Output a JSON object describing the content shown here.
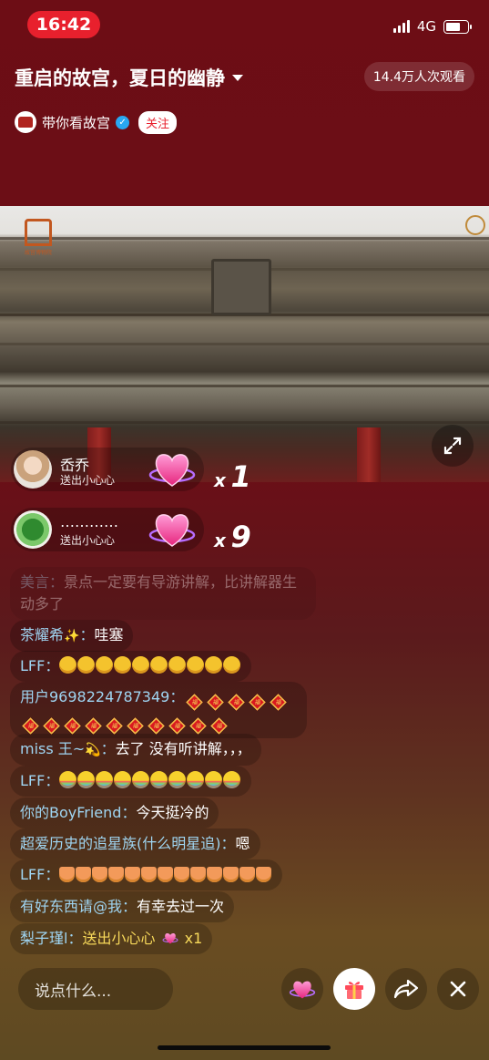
{
  "status_bar": {
    "time": "16:42",
    "network": "4G"
  },
  "header": {
    "title": "重启的故宫，夏日的幽静",
    "viewers": "14.4万人次观看",
    "host_name": "带你看故宫",
    "follow_label": "关注"
  },
  "gifts": [
    {
      "user": "岙乔",
      "action": "送出小心心",
      "x": "x",
      "count": "1"
    },
    {
      "user": "…………",
      "action": "送出小心心",
      "x": "x",
      "count": "9"
    }
  ],
  "comments": [
    {
      "user": "美言",
      "sep": "：",
      "text": "景点一定要有导游讲解，比讲解器生动多了"
    },
    {
      "user": "茶耀希",
      "sep": "：",
      "text": "哇塞"
    },
    {
      "user": "LFF",
      "sep": "："
    },
    {
      "user": "用户9698224787349",
      "sep": "："
    },
    {
      "user": "miss 王~",
      "sep": "：",
      "text": "去了 没有听讲解，，，"
    },
    {
      "user": "LFF",
      "sep": "："
    },
    {
      "user": "你的BoyFriend",
      "sep": "：",
      "text": "今天挺冷的"
    },
    {
      "user": "超爱历史的追星族(什么明星追)",
      "sep": "：",
      "text": "嗯"
    },
    {
      "user": "LFF",
      "sep": "："
    },
    {
      "user": "有好东西请@我",
      "sep": "：",
      "text": "有幸去过一次"
    },
    {
      "user": "梨子瑾l",
      "sep": "：",
      "text": "送出小心心",
      "suffix": "x1"
    }
  ],
  "fu_char": "福",
  "input": {
    "placeholder": "说点什么..."
  },
  "icons": {
    "expand": "expand-icon",
    "heart": "heart-icon",
    "gift": "gift-icon",
    "share": "share-icon",
    "close": "close-icon"
  },
  "colors": {
    "accent_red": "#e8202d",
    "username_blue": "#9fd5f2",
    "gift_text_yellow": "#f7d95a"
  }
}
